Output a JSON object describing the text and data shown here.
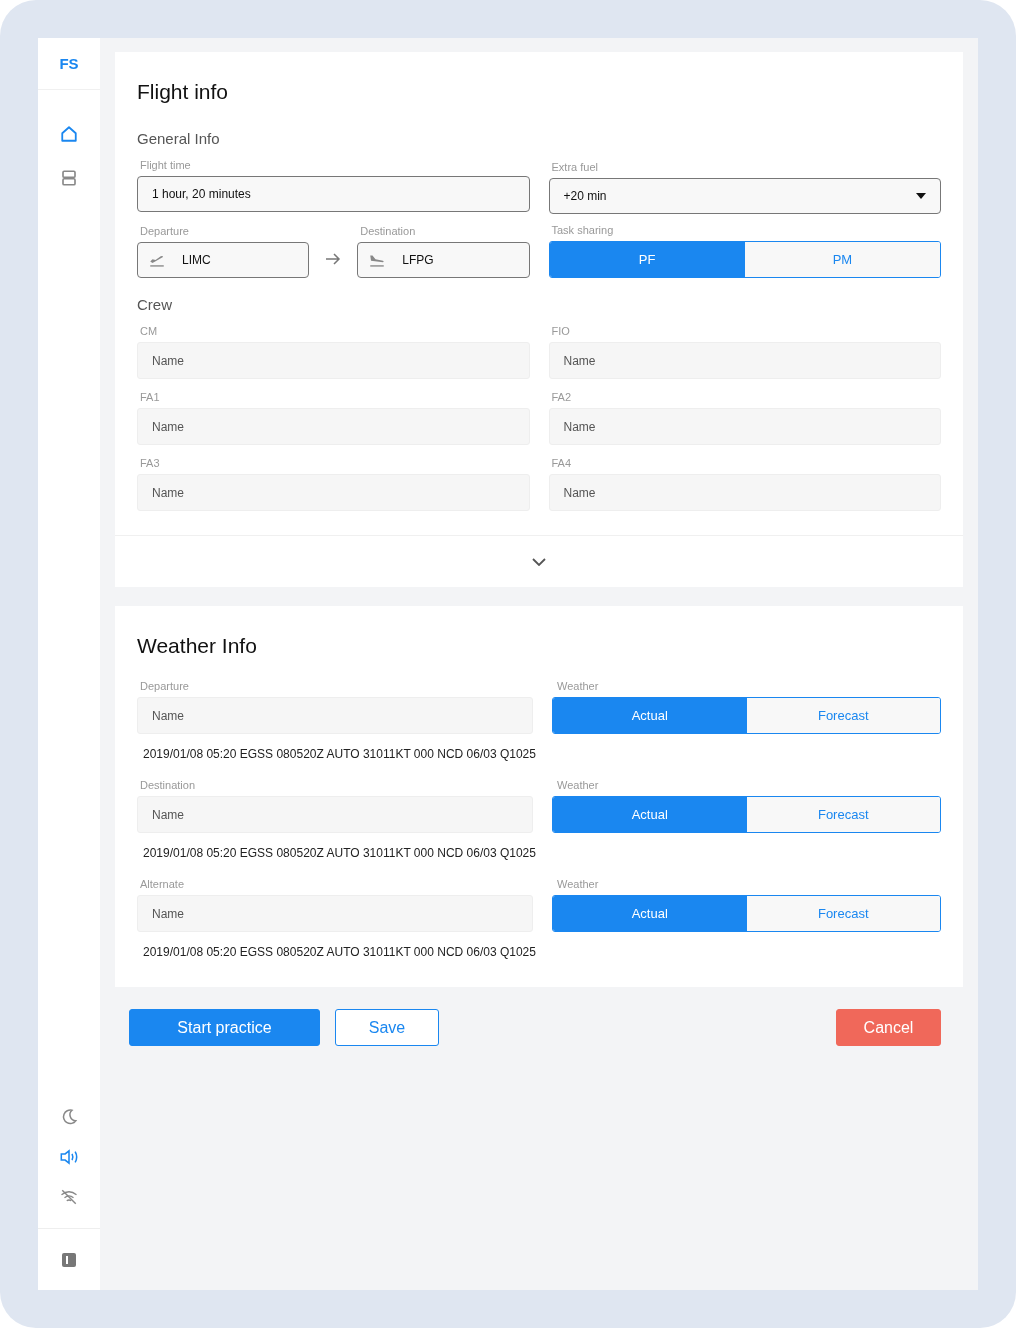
{
  "sidebar": {
    "logo": "FS",
    "nav": [
      {
        "kind": "home",
        "selected": true
      },
      {
        "kind": "list",
        "selected": false
      }
    ],
    "settings": [
      {
        "kind": "dark-mode",
        "on": false
      },
      {
        "kind": "sound",
        "on": true
      },
      {
        "kind": "wifi",
        "on": false
      }
    ]
  },
  "flight_info": {
    "title": "Flight info",
    "general_heading": "General Info",
    "flight_time": {
      "label": "Flight time",
      "value": "1 hour, 20 minutes"
    },
    "extra_fuel": {
      "label": "Extra fuel",
      "value": "+20 min"
    },
    "departure": {
      "label": "Departure",
      "value": "LIMC"
    },
    "destination": {
      "label": "Destination",
      "value": "LFPG"
    },
    "task_sharing": {
      "label": "Task sharing",
      "options": [
        {
          "label": "PF",
          "selected": true
        },
        {
          "label": "PM",
          "selected": false
        }
      ]
    },
    "crew_heading": "Crew",
    "crew": [
      {
        "label": "CM",
        "placeholder": "Name"
      },
      {
        "label": "FIO",
        "placeholder": "Name"
      },
      {
        "label": "FA1",
        "placeholder": "Name"
      },
      {
        "label": "FA2",
        "placeholder": "Name"
      },
      {
        "label": "FA3",
        "placeholder": "Name"
      },
      {
        "label": "FA4",
        "placeholder": "Name"
      }
    ]
  },
  "weather_info": {
    "title": "Weather Info",
    "rows": [
      {
        "label": "Departure",
        "placeholder": "Name",
        "weather_label": "Weather",
        "options": [
          {
            "label": "Actual",
            "selected": true
          },
          {
            "label": "Forecast",
            "selected": false
          }
        ],
        "report": "2019/01/08 05:20 EGSS 080520Z AUTO 31011KT 000 NCD 06/03 Q1025"
      },
      {
        "label": "Destination",
        "placeholder": "Name",
        "weather_label": "Weather",
        "options": [
          {
            "label": "Actual",
            "selected": true
          },
          {
            "label": "Forecast",
            "selected": false
          }
        ],
        "report": "2019/01/08 05:20 EGSS 080520Z AUTO 31011KT 000 NCD 06/03 Q1025"
      },
      {
        "label": "Alternate",
        "placeholder": "Name",
        "weather_label": "Weather",
        "options": [
          {
            "label": "Actual",
            "selected": true
          },
          {
            "label": "Forecast",
            "selected": false
          }
        ],
        "report": "2019/01/08 05:20 EGSS 080520Z AUTO 31011KT 000 NCD 06/03 Q1025"
      }
    ]
  },
  "actions": {
    "start": "Start practice",
    "save": "Save",
    "cancel": "Cancel"
  }
}
